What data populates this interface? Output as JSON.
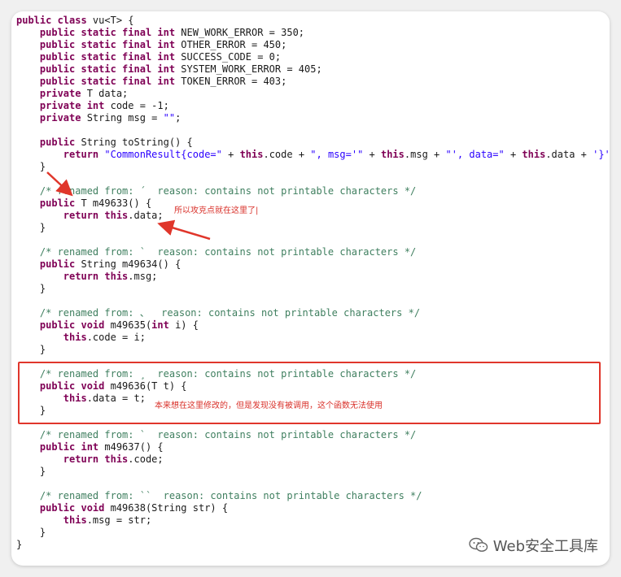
{
  "code": {
    "lines": [
      {
        "tokens": [
          {
            "t": "public class ",
            "c": "kw"
          },
          {
            "t": "vu<T> {",
            "c": ""
          }
        ]
      },
      {
        "tokens": [
          {
            "t": "    public static final int ",
            "c": "kw"
          },
          {
            "t": "NEW_WORK_ERROR = 350;",
            "c": ""
          }
        ]
      },
      {
        "tokens": [
          {
            "t": "    public static final int ",
            "c": "kw"
          },
          {
            "t": "OTHER_ERROR = 450;",
            "c": ""
          }
        ]
      },
      {
        "tokens": [
          {
            "t": "    public static final int ",
            "c": "kw"
          },
          {
            "t": "SUCCESS_CODE = 0;",
            "c": ""
          }
        ]
      },
      {
        "tokens": [
          {
            "t": "    public static final int ",
            "c": "kw"
          },
          {
            "t": "SYSTEM_WORK_ERROR = 405;",
            "c": ""
          }
        ]
      },
      {
        "tokens": [
          {
            "t": "    public static final int ",
            "c": "kw"
          },
          {
            "t": "TOKEN_ERROR = 403;",
            "c": ""
          }
        ]
      },
      {
        "tokens": [
          {
            "t": "    private ",
            "c": "kw"
          },
          {
            "t": "T data;",
            "c": ""
          }
        ]
      },
      {
        "tokens": [
          {
            "t": "    private int ",
            "c": "kw"
          },
          {
            "t": "code = -1;",
            "c": ""
          }
        ]
      },
      {
        "tokens": [
          {
            "t": "    private ",
            "c": "kw"
          },
          {
            "t": "String msg = ",
            "c": ""
          },
          {
            "t": "\"\"",
            "c": "str"
          },
          {
            "t": ";",
            "c": ""
          }
        ]
      },
      {
        "tokens": []
      },
      {
        "tokens": [
          {
            "t": "    public ",
            "c": "kw"
          },
          {
            "t": "String toString() {",
            "c": ""
          }
        ]
      },
      {
        "tokens": [
          {
            "t": "        return ",
            "c": "kw"
          },
          {
            "t": "\"CommonResult{code=\"",
            "c": "str"
          },
          {
            "t": " + ",
            "c": ""
          },
          {
            "t": "this",
            "c": "kw"
          },
          {
            "t": ".code + ",
            "c": ""
          },
          {
            "t": "\", msg='\"",
            "c": "str"
          },
          {
            "t": " + ",
            "c": ""
          },
          {
            "t": "this",
            "c": "kw"
          },
          {
            "t": ".msg + ",
            "c": ""
          },
          {
            "t": "\"', data=\"",
            "c": "str"
          },
          {
            "t": " + ",
            "c": ""
          },
          {
            "t": "this",
            "c": "kw"
          },
          {
            "t": ".data + ",
            "c": ""
          },
          {
            "t": "'}'",
            "c": "str"
          },
          {
            "t": ";",
            "c": ""
          }
        ]
      },
      {
        "tokens": [
          {
            "t": "    }",
            "c": ""
          }
        ]
      },
      {
        "tokens": []
      },
      {
        "tokens": [
          {
            "t": "    /* renamed from: ´  reason: contains not printable characters */",
            "c": "cmt"
          }
        ]
      },
      {
        "tokens": [
          {
            "t": "    public ",
            "c": "kw"
          },
          {
            "t": "T m49633() {",
            "c": ""
          }
        ]
      },
      {
        "tokens": [
          {
            "t": "        return this",
            "c": "kw"
          },
          {
            "t": ".data;",
            "c": ""
          }
        ]
      },
      {
        "tokens": [
          {
            "t": "    }",
            "c": ""
          }
        ]
      },
      {
        "tokens": []
      },
      {
        "tokens": [
          {
            "t": "    /* renamed from: `  reason: contains not printable characters */",
            "c": "cmt"
          }
        ]
      },
      {
        "tokens": [
          {
            "t": "    public ",
            "c": "kw"
          },
          {
            "t": "String m49634() {",
            "c": ""
          }
        ]
      },
      {
        "tokens": [
          {
            "t": "        return this",
            "c": "kw"
          },
          {
            "t": ".msg;",
            "c": ""
          }
        ]
      },
      {
        "tokens": [
          {
            "t": "    }",
            "c": ""
          }
        ]
      },
      {
        "tokens": []
      },
      {
        "tokens": [
          {
            "t": "    /* renamed from: 、  reason: contains not printable characters */",
            "c": "cmt"
          }
        ]
      },
      {
        "tokens": [
          {
            "t": "    public void ",
            "c": "kw"
          },
          {
            "t": "m49635(",
            "c": ""
          },
          {
            "t": "int ",
            "c": "kw"
          },
          {
            "t": "i) {",
            "c": ""
          }
        ]
      },
      {
        "tokens": [
          {
            "t": "        this",
            "c": "kw"
          },
          {
            "t": ".code = i;",
            "c": ""
          }
        ]
      },
      {
        "tokens": [
          {
            "t": "    }",
            "c": ""
          }
        ]
      },
      {
        "tokens": []
      },
      {
        "tokens": [
          {
            "t": "    /* renamed from: ¸  reason: contains not printable characters */",
            "c": "cmt"
          }
        ]
      },
      {
        "tokens": [
          {
            "t": "    public void ",
            "c": "kw"
          },
          {
            "t": "m49636(T t) {",
            "c": ""
          }
        ]
      },
      {
        "tokens": [
          {
            "t": "        this",
            "c": "kw"
          },
          {
            "t": ".data = t;",
            "c": ""
          }
        ]
      },
      {
        "tokens": [
          {
            "t": "    }",
            "c": ""
          }
        ]
      },
      {
        "tokens": []
      },
      {
        "tokens": [
          {
            "t": "    /* renamed from: `  reason: contains not printable characters */",
            "c": "cmt"
          }
        ]
      },
      {
        "tokens": [
          {
            "t": "    public int ",
            "c": "kw"
          },
          {
            "t": "m49637() {",
            "c": ""
          }
        ]
      },
      {
        "tokens": [
          {
            "t": "        return this",
            "c": "kw"
          },
          {
            "t": ".code;",
            "c": ""
          }
        ]
      },
      {
        "tokens": [
          {
            "t": "    }",
            "c": ""
          }
        ]
      },
      {
        "tokens": []
      },
      {
        "tokens": [
          {
            "t": "    /* renamed from: ``  reason: contains not printable characters */",
            "c": "cmt"
          }
        ]
      },
      {
        "tokens": [
          {
            "t": "    public void ",
            "c": "kw"
          },
          {
            "t": "m49638(String str) {",
            "c": ""
          }
        ]
      },
      {
        "tokens": [
          {
            "t": "        this",
            "c": "kw"
          },
          {
            "t": ".msg = str;",
            "c": ""
          }
        ]
      },
      {
        "tokens": [
          {
            "t": "    }",
            "c": ""
          }
        ]
      },
      {
        "tokens": [
          {
            "t": "}",
            "c": ""
          }
        ]
      }
    ]
  },
  "annotations": {
    "note_1": "所以攻克点就在这里了|",
    "note_2": "本来想在这里修改的，但是发现没有被调用，这个函数无法使用"
  },
  "watermark": {
    "text": "Web安全工具库",
    "icon": "wechat-icon"
  },
  "colors": {
    "keyword": "#7f0055",
    "string": "#2a00ff",
    "comment": "#3f7f5f",
    "annotation_red": "#e0362b"
  }
}
